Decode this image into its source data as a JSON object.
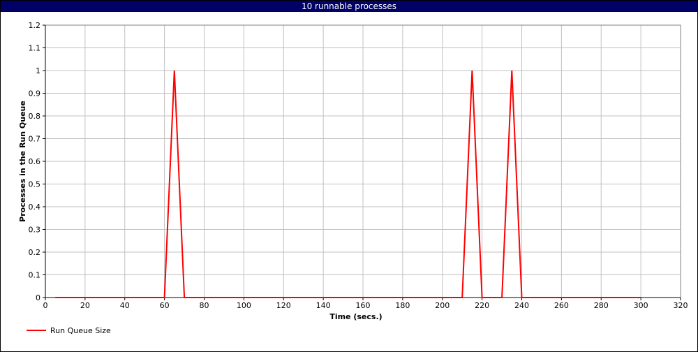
{
  "window": {
    "title": "10 runnable processes"
  },
  "colors": {
    "title_bar_bg": "#000066",
    "title_text": "#ffffff",
    "series": "#ff0000",
    "grid": "#c0c0c0",
    "axis": "#000000"
  },
  "chart_data": {
    "type": "line",
    "title": "10 runnable processes",
    "xlabel": "Time (secs.)",
    "ylabel": "Processes in the Run Queue",
    "xlim": [
      0,
      320
    ],
    "ylim": [
      0,
      1.2
    ],
    "x_ticks": [
      "0",
      "20",
      "40",
      "60",
      "80",
      "100",
      "120",
      "140",
      "160",
      "180",
      "200",
      "220",
      "240",
      "260",
      "280",
      "300",
      "320"
    ],
    "y_ticks": [
      "0",
      "0.1",
      "0.2",
      "0.3",
      "0.4",
      "0.5",
      "0.6",
      "0.7",
      "0.8",
      "0.9",
      "1",
      "1.1",
      "1.2"
    ],
    "grid": true,
    "legend_position": "bottom-left",
    "series": [
      {
        "name": "Run Queue Size",
        "color": "#ff0000",
        "x": [
          5,
          10,
          15,
          20,
          25,
          30,
          35,
          40,
          45,
          50,
          55,
          60,
          65,
          70,
          75,
          80,
          85,
          90,
          95,
          100,
          105,
          110,
          115,
          120,
          125,
          130,
          135,
          140,
          145,
          150,
          155,
          160,
          165,
          170,
          175,
          180,
          185,
          190,
          195,
          200,
          205,
          210,
          215,
          220,
          225,
          230,
          235,
          240,
          245,
          250,
          255,
          260,
          265,
          270,
          275,
          280,
          285,
          290,
          295,
          300
        ],
        "y": [
          0,
          0,
          0,
          0,
          0,
          0,
          0,
          0,
          0,
          0,
          0,
          0,
          1,
          0,
          0,
          0,
          0,
          0,
          0,
          0,
          0,
          0,
          0,
          0,
          0,
          0,
          0,
          0,
          0,
          0,
          0,
          0,
          0,
          0,
          0,
          0,
          0,
          0,
          0,
          0,
          0,
          0,
          1,
          0,
          0,
          0,
          1,
          0,
          0,
          0,
          0,
          0,
          0,
          0,
          0,
          0,
          0,
          0,
          0,
          0
        ]
      }
    ]
  }
}
